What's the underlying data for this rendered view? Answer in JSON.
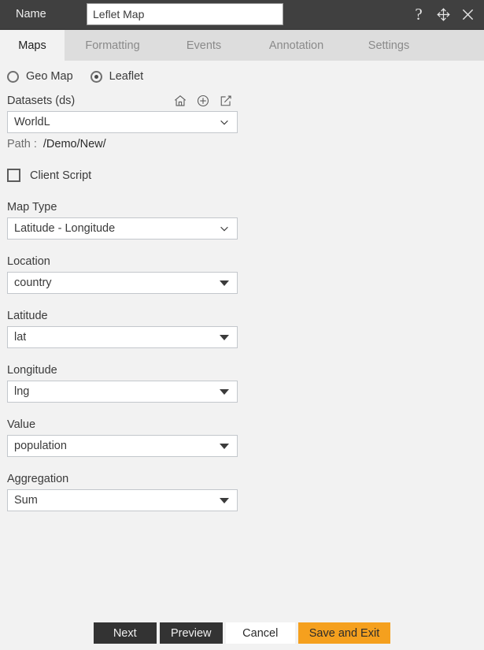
{
  "titlebar": {
    "name_label": "Name",
    "name_value": "Leflet Map",
    "name_placeholder": "Name",
    "help_icon": "question-mark-icon",
    "move_icon": "move-arrows-icon",
    "close_icon": "close-x-icon"
  },
  "tabs": [
    {
      "label": "Maps",
      "active": true
    },
    {
      "label": "Formatting",
      "active": false
    },
    {
      "label": "Events",
      "active": false
    },
    {
      "label": "Annotation",
      "active": false
    },
    {
      "label": "Settings",
      "active": false
    }
  ],
  "map_source": {
    "options": [
      {
        "label": "Geo Map",
        "selected": false
      },
      {
        "label": "Leaflet",
        "selected": true
      }
    ]
  },
  "datasets": {
    "label": "Datasets (ds)",
    "icons": [
      "home-icon",
      "plus-circle-icon",
      "edit-square-icon"
    ],
    "selected": "WorldL",
    "path_label": "Path :",
    "path_value": "/Demo/New/"
  },
  "client_script": {
    "label": "Client Script",
    "checked": false
  },
  "fields": [
    {
      "label": "Map Type",
      "value": "Latitude - Longitude",
      "arrow": "chevron"
    },
    {
      "label": "Location",
      "value": "country",
      "arrow": "caret"
    },
    {
      "label": "Latitude",
      "value": "lat",
      "arrow": "caret"
    },
    {
      "label": "Longitude",
      "value": "lng",
      "arrow": "caret"
    },
    {
      "label": "Value",
      "value": "population",
      "arrow": "caret"
    },
    {
      "label": "Aggregation",
      "value": "Sum",
      "arrow": "caret"
    }
  ],
  "footer": {
    "next": "Next",
    "preview": "Preview",
    "cancel": "Cancel",
    "save_and_exit": "Save and Exit"
  },
  "colors": {
    "titlebar": "#404040",
    "tabstrip": "#dddddd",
    "background": "#f2f2f2",
    "accent": "#f5a01e",
    "dark_button": "#333333"
  }
}
